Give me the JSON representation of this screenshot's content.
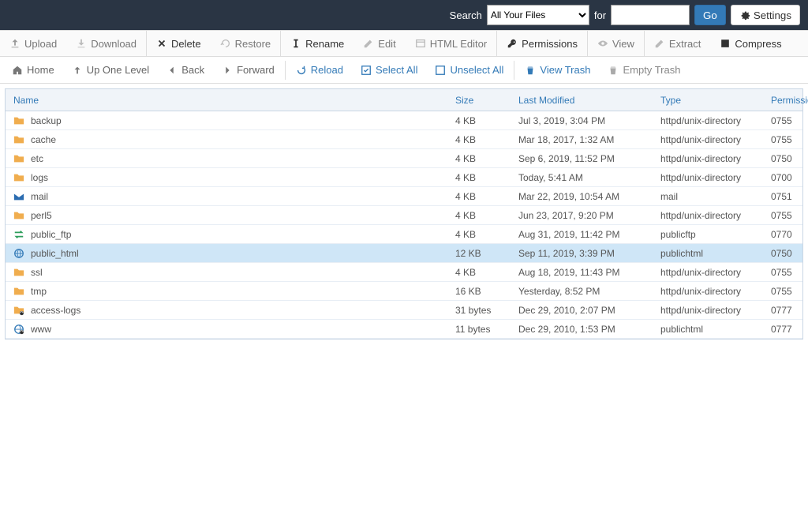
{
  "topbar": {
    "search_label": "Search",
    "scope_selected": "All Your Files",
    "for_label": "for",
    "search_value": "",
    "go_label": "Go",
    "settings_label": "Settings"
  },
  "toolbar1": {
    "upload": "Upload",
    "download": "Download",
    "delete": "Delete",
    "restore": "Restore",
    "rename": "Rename",
    "edit": "Edit",
    "html_editor": "HTML Editor",
    "permissions": "Permissions",
    "view": "View",
    "extract": "Extract",
    "compress": "Compress"
  },
  "toolbar2": {
    "home": "Home",
    "up": "Up One Level",
    "back": "Back",
    "forward": "Forward",
    "reload": "Reload",
    "select_all": "Select All",
    "unselect_all": "Unselect All",
    "view_trash": "View Trash",
    "empty_trash": "Empty Trash"
  },
  "columns": {
    "name": "Name",
    "size": "Size",
    "last_modified": "Last Modified",
    "type": "Type",
    "permissions": "Permissions"
  },
  "rows": [
    {
      "icon": "folder",
      "name": "backup",
      "size": "4 KB",
      "mod": "Jul 3, 2019, 3:04 PM",
      "type": "httpd/unix-directory",
      "perm": "0755",
      "selected": false
    },
    {
      "icon": "folder",
      "name": "cache",
      "size": "4 KB",
      "mod": "Mar 18, 2017, 1:32 AM",
      "type": "httpd/unix-directory",
      "perm": "0755",
      "selected": false
    },
    {
      "icon": "folder",
      "name": "etc",
      "size": "4 KB",
      "mod": "Sep 6, 2019, 11:52 PM",
      "type": "httpd/unix-directory",
      "perm": "0750",
      "selected": false
    },
    {
      "icon": "folder",
      "name": "logs",
      "size": "4 KB",
      "mod": "Today, 5:41 AM",
      "type": "httpd/unix-directory",
      "perm": "0700",
      "selected": false
    },
    {
      "icon": "mail",
      "name": "mail",
      "size": "4 KB",
      "mod": "Mar 22, 2019, 10:54 AM",
      "type": "mail",
      "perm": "0751",
      "selected": false
    },
    {
      "icon": "folder",
      "name": "perl5",
      "size": "4 KB",
      "mod": "Jun 23, 2017, 9:20 PM",
      "type": "httpd/unix-directory",
      "perm": "0755",
      "selected": false
    },
    {
      "icon": "ftp",
      "name": "public_ftp",
      "size": "4 KB",
      "mod": "Aug 31, 2019, 11:42 PM",
      "type": "publicftp",
      "perm": "0770",
      "selected": false
    },
    {
      "icon": "globe",
      "name": "public_html",
      "size": "12 KB",
      "mod": "Sep 11, 2019, 3:39 PM",
      "type": "publichtml",
      "perm": "0750",
      "selected": true
    },
    {
      "icon": "folder",
      "name": "ssl",
      "size": "4 KB",
      "mod": "Aug 18, 2019, 11:43 PM",
      "type": "httpd/unix-directory",
      "perm": "0755",
      "selected": false
    },
    {
      "icon": "folder",
      "name": "tmp",
      "size": "16 KB",
      "mod": "Yesterday, 8:52 PM",
      "type": "httpd/unix-directory",
      "perm": "0755",
      "selected": false
    },
    {
      "icon": "linkf",
      "name": "access-logs",
      "size": "31 bytes",
      "mod": "Dec 29, 2010, 2:07 PM",
      "type": "httpd/unix-directory",
      "perm": "0777",
      "selected": false
    },
    {
      "icon": "linkg",
      "name": "www",
      "size": "11 bytes",
      "mod": "Dec 29, 2010, 1:53 PM",
      "type": "publichtml",
      "perm": "0777",
      "selected": false
    }
  ]
}
